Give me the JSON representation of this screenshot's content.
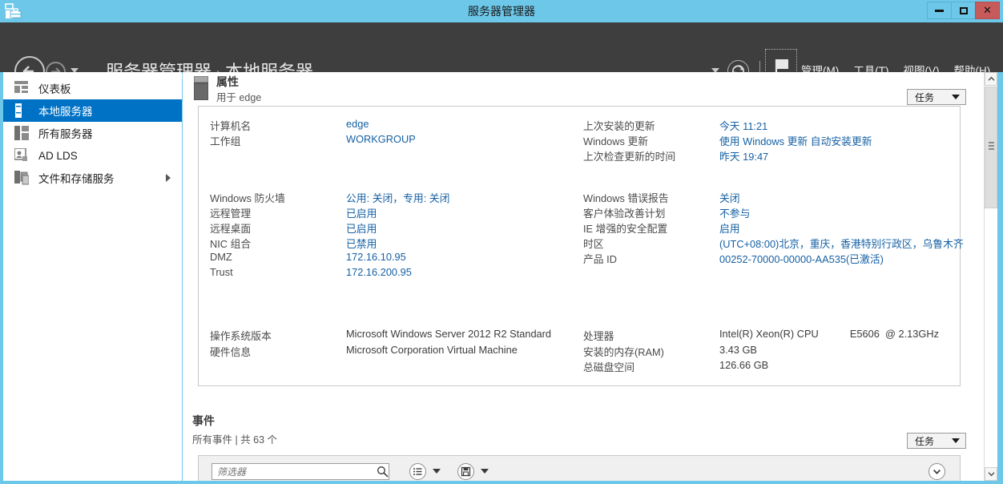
{
  "window": {
    "title": "服务器管理器",
    "app_icon": "server-manager-icon",
    "minimize_label": "最小化",
    "maximize_label": "最大化",
    "close_label": "关闭",
    "titlebar_color": "#6cc7e8"
  },
  "nav": {
    "back_icon": "arrow-left-icon",
    "forward_icon": "arrow-right-icon",
    "history_caret": "chevron-down-icon",
    "breadcrumb": {
      "root": "服务器管理器",
      "separator": "›",
      "current": "本地服务器"
    },
    "right_caret": "chevron-down-icon",
    "refresh_icon": "refresh-icon",
    "flag_icon": "flag-notification-icon",
    "menus": [
      {
        "label": "管理",
        "accel": "M"
      },
      {
        "label": "工具",
        "accel": "T"
      },
      {
        "label": "视图",
        "accel": "V"
      },
      {
        "label": "帮助",
        "accel": "H"
      }
    ],
    "navbar_color": "#3e3e3e"
  },
  "sidebar": {
    "selected_color": "#0072c6",
    "items": [
      {
        "label": "仪表板",
        "icon": "dashboard-icon",
        "selected": false,
        "has_submenu": false
      },
      {
        "label": "本地服务器",
        "icon": "server-icon",
        "selected": true,
        "has_submenu": false
      },
      {
        "label": "所有服务器",
        "icon": "all-servers-icon",
        "selected": false,
        "has_submenu": false
      },
      {
        "label": "AD LDS",
        "icon": "ad-lds-icon",
        "selected": false,
        "has_submenu": false
      },
      {
        "label": "文件和存储服务",
        "icon": "file-storage-icon",
        "selected": false,
        "has_submenu": true
      }
    ]
  },
  "properties": {
    "title": "属性",
    "subtitle": "用于 edge",
    "icon": "server-icon",
    "tasks_label": "任务",
    "tasks_caret": "chevron-down-icon",
    "group1_left": [
      {
        "label": "计算机名",
        "value": "edge",
        "link": true
      },
      {
        "label": "工作组",
        "value": "WORKGROUP",
        "link": true
      }
    ],
    "group1_right": [
      {
        "label": "上次安装的更新",
        "value": "今天 11:21",
        "link": true
      },
      {
        "label": "Windows 更新",
        "value": "使用 Windows 更新 自动安装更新",
        "link": true
      },
      {
        "label": "上次检查更新的时间",
        "value": "昨天 19:47",
        "link": true
      }
    ],
    "group2_left": [
      {
        "label": "Windows 防火墙",
        "value": "公用: 关闭，专用: 关闭",
        "link": true
      },
      {
        "label": "远程管理",
        "value": "已启用",
        "link": true
      },
      {
        "label": "远程桌面",
        "value": "已启用",
        "link": true
      },
      {
        "label": "NIC 组合",
        "value": "已禁用",
        "link": true
      },
      {
        "label": "DMZ",
        "value": "172.16.10.95",
        "link": true
      },
      {
        "label": "Trust",
        "value": "172.16.200.95",
        "link": true
      }
    ],
    "group2_right": [
      {
        "label": "Windows 错误报告",
        "value": "关闭",
        "link": true
      },
      {
        "label": "客户体验改善计划",
        "value": "不参与",
        "link": true
      },
      {
        "label": "IE 增强的安全配置",
        "value": "启用",
        "link": true
      },
      {
        "label": "时区",
        "value": "(UTC+08:00)北京，重庆，香港特别行政区，乌鲁木齐",
        "link": true
      },
      {
        "label": "产品 ID",
        "value": "00252-70000-00000-AA535(已激活)",
        "link": true
      }
    ],
    "group3_left": [
      {
        "label": "操作系统版本",
        "value": "Microsoft Windows Server 2012 R2 Standard",
        "link": false
      },
      {
        "label": "硬件信息",
        "value": "Microsoft Corporation Virtual Machine",
        "link": false
      }
    ],
    "group3_right": [
      {
        "label": "处理器",
        "value": "Intel(R) Xeon(R) CPU           E5606  @ 2.13GHz",
        "link": false
      },
      {
        "label": "安装的内存(RAM)",
        "value": "3.43 GB",
        "link": false
      },
      {
        "label": "总磁盘空间",
        "value": "126.66 GB",
        "link": false
      }
    ]
  },
  "events": {
    "title": "事件",
    "subtitle": "所有事件 | 共 63 个",
    "tasks_label": "任务",
    "tasks_caret": "chevron-down-icon",
    "filter_placeholder": "筛选器",
    "filter_value": "",
    "search_icon": "search-icon",
    "query_icon": "query-list-icon",
    "save_icon": "save-icon",
    "expand_icon": "chevron-down-circle-icon"
  },
  "scrollbar": {
    "up_icon": "chevron-up-icon",
    "down_icon": "chevron-down-icon",
    "grip_icon": "grip-icon"
  }
}
